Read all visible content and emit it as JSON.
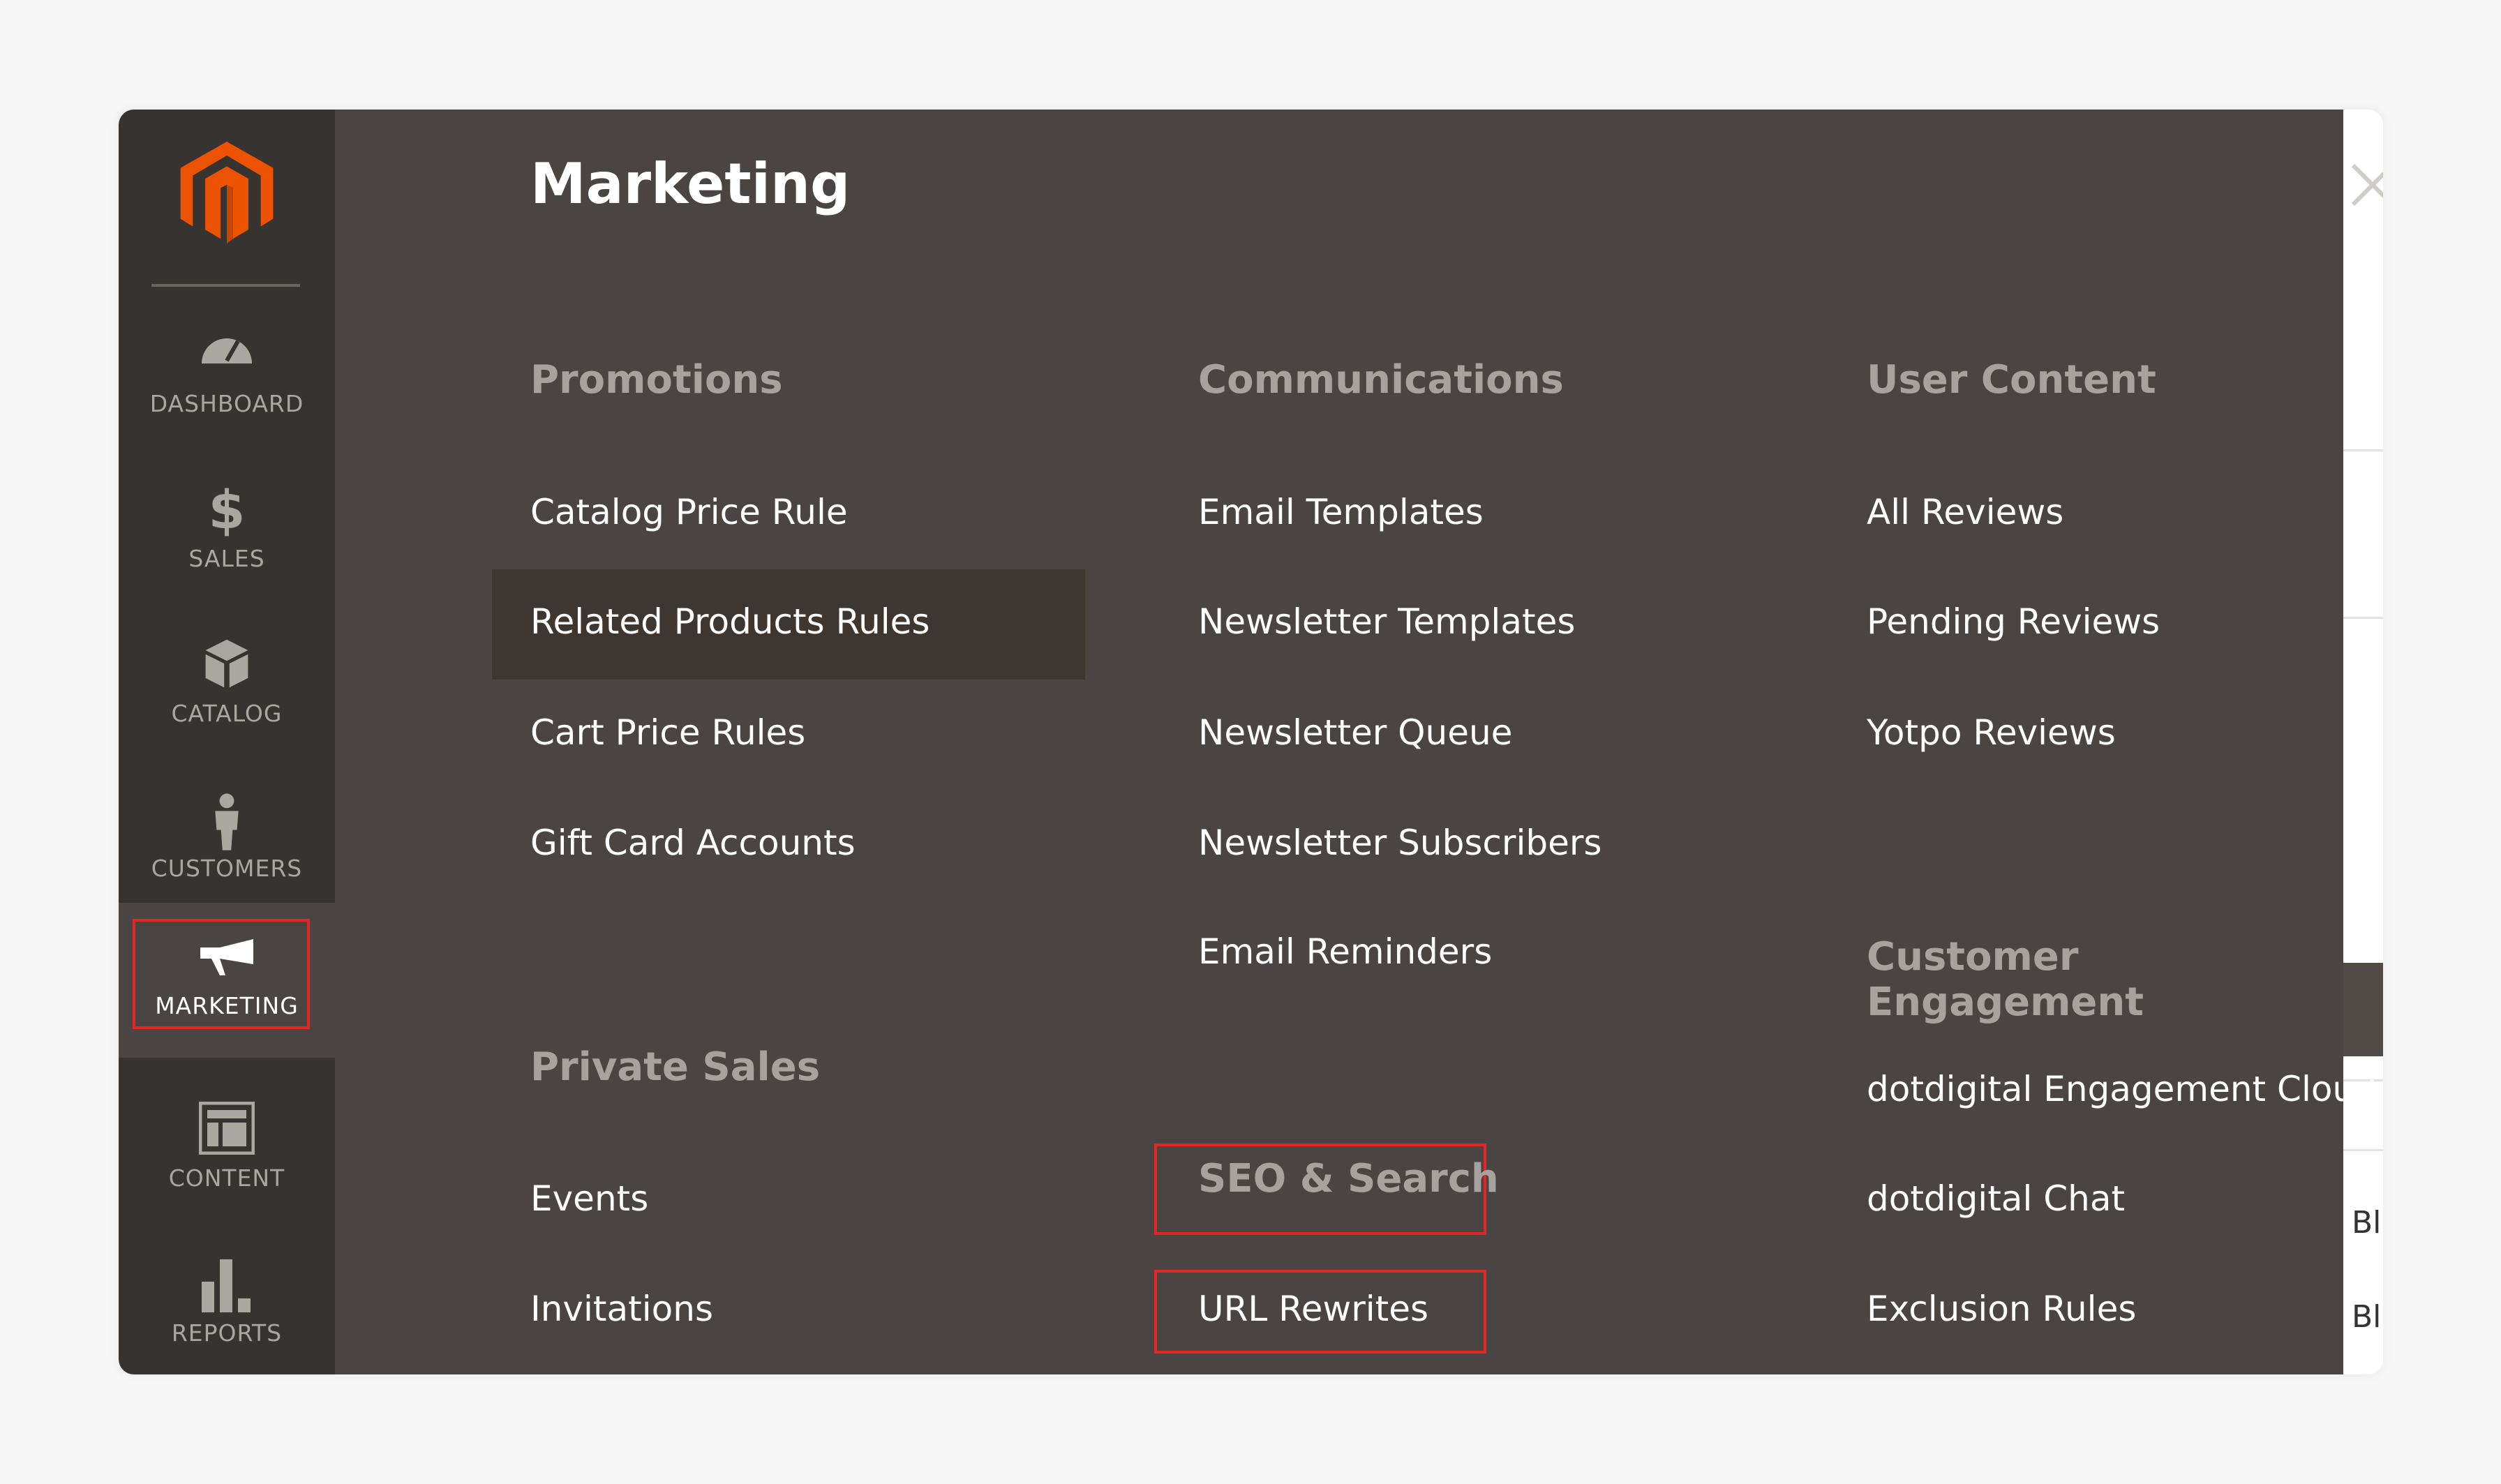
{
  "sidebar": {
    "logo": "Magento",
    "items": [
      {
        "label": "DASHBOARD",
        "icon": "dashboard-icon"
      },
      {
        "label": "SALES",
        "icon": "dollar-icon"
      },
      {
        "label": "CATALOG",
        "icon": "box-icon"
      },
      {
        "label": "CUSTOMERS",
        "icon": "person-icon"
      },
      {
        "label": "MARKETING",
        "icon": "megaphone-icon",
        "active": true
      },
      {
        "label": "CONTENT",
        "icon": "layout-icon"
      },
      {
        "label": "REPORTS",
        "icon": "bar-chart-icon"
      }
    ]
  },
  "panel": {
    "title": "Marketing",
    "close_icon": "close-icon",
    "promotions": {
      "header": "Promotions",
      "items": [
        "Catalog Price Rule",
        "Related Products Rules",
        "Cart Price Rules",
        "Gift Card Accounts"
      ]
    },
    "private_sales": {
      "header": "Private Sales",
      "items": [
        "Events",
        "Invitations"
      ]
    },
    "communications": {
      "header": "Communications",
      "items": [
        "Email Templates",
        "Newsletter Templates",
        "Newsletter Queue",
        "Newsletter Subscribers",
        "Email Reminders"
      ]
    },
    "seo": {
      "header": "SEO & Search",
      "items": [
        "URL Rewrites"
      ]
    },
    "user_content": {
      "header": "User Content",
      "items": [
        "All Reviews",
        "Pending Reviews",
        "Yotpo Reviews"
      ]
    },
    "customer_engagement": {
      "header": "Customer Engagement",
      "items": [
        "dotdigital Engagement Cloud",
        "dotdigital Chat",
        "Exclusion Rules"
      ]
    }
  },
  "background": {
    "row_text": [
      "Bl",
      "Bl"
    ]
  },
  "colors": {
    "accent": "#eb5202",
    "highlight_border": "#e22626",
    "sidebar": "#373330",
    "panel": "#4a4542"
  }
}
